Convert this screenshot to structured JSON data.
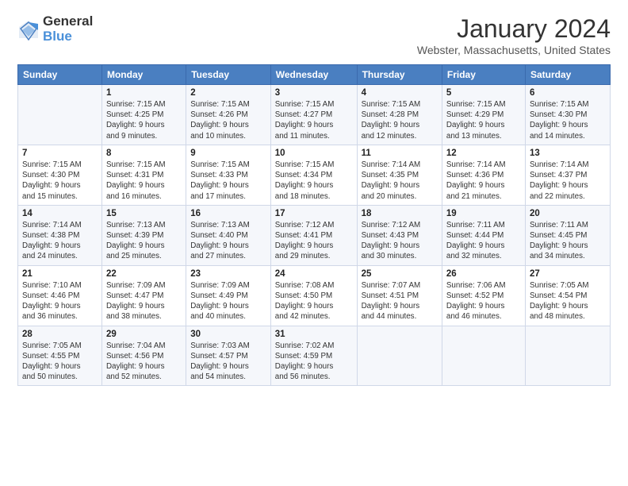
{
  "header": {
    "logo_general": "General",
    "logo_blue": "Blue",
    "month_year": "January 2024",
    "location": "Webster, Massachusetts, United States"
  },
  "days_of_week": [
    "Sunday",
    "Monday",
    "Tuesday",
    "Wednesday",
    "Thursday",
    "Friday",
    "Saturday"
  ],
  "weeks": [
    [
      {
        "day": "",
        "info": ""
      },
      {
        "day": "1",
        "info": "Sunrise: 7:15 AM\nSunset: 4:25 PM\nDaylight: 9 hours\nand 9 minutes."
      },
      {
        "day": "2",
        "info": "Sunrise: 7:15 AM\nSunset: 4:26 PM\nDaylight: 9 hours\nand 10 minutes."
      },
      {
        "day": "3",
        "info": "Sunrise: 7:15 AM\nSunset: 4:27 PM\nDaylight: 9 hours\nand 11 minutes."
      },
      {
        "day": "4",
        "info": "Sunrise: 7:15 AM\nSunset: 4:28 PM\nDaylight: 9 hours\nand 12 minutes."
      },
      {
        "day": "5",
        "info": "Sunrise: 7:15 AM\nSunset: 4:29 PM\nDaylight: 9 hours\nand 13 minutes."
      },
      {
        "day": "6",
        "info": "Sunrise: 7:15 AM\nSunset: 4:30 PM\nDaylight: 9 hours\nand 14 minutes."
      }
    ],
    [
      {
        "day": "7",
        "info": "Sunrise: 7:15 AM\nSunset: 4:30 PM\nDaylight: 9 hours\nand 15 minutes."
      },
      {
        "day": "8",
        "info": "Sunrise: 7:15 AM\nSunset: 4:31 PM\nDaylight: 9 hours\nand 16 minutes."
      },
      {
        "day": "9",
        "info": "Sunrise: 7:15 AM\nSunset: 4:33 PM\nDaylight: 9 hours\nand 17 minutes."
      },
      {
        "day": "10",
        "info": "Sunrise: 7:15 AM\nSunset: 4:34 PM\nDaylight: 9 hours\nand 18 minutes."
      },
      {
        "day": "11",
        "info": "Sunrise: 7:14 AM\nSunset: 4:35 PM\nDaylight: 9 hours\nand 20 minutes."
      },
      {
        "day": "12",
        "info": "Sunrise: 7:14 AM\nSunset: 4:36 PM\nDaylight: 9 hours\nand 21 minutes."
      },
      {
        "day": "13",
        "info": "Sunrise: 7:14 AM\nSunset: 4:37 PM\nDaylight: 9 hours\nand 22 minutes."
      }
    ],
    [
      {
        "day": "14",
        "info": "Sunrise: 7:14 AM\nSunset: 4:38 PM\nDaylight: 9 hours\nand 24 minutes."
      },
      {
        "day": "15",
        "info": "Sunrise: 7:13 AM\nSunset: 4:39 PM\nDaylight: 9 hours\nand 25 minutes."
      },
      {
        "day": "16",
        "info": "Sunrise: 7:13 AM\nSunset: 4:40 PM\nDaylight: 9 hours\nand 27 minutes."
      },
      {
        "day": "17",
        "info": "Sunrise: 7:12 AM\nSunset: 4:41 PM\nDaylight: 9 hours\nand 29 minutes."
      },
      {
        "day": "18",
        "info": "Sunrise: 7:12 AM\nSunset: 4:43 PM\nDaylight: 9 hours\nand 30 minutes."
      },
      {
        "day": "19",
        "info": "Sunrise: 7:11 AM\nSunset: 4:44 PM\nDaylight: 9 hours\nand 32 minutes."
      },
      {
        "day": "20",
        "info": "Sunrise: 7:11 AM\nSunset: 4:45 PM\nDaylight: 9 hours\nand 34 minutes."
      }
    ],
    [
      {
        "day": "21",
        "info": "Sunrise: 7:10 AM\nSunset: 4:46 PM\nDaylight: 9 hours\nand 36 minutes."
      },
      {
        "day": "22",
        "info": "Sunrise: 7:09 AM\nSunset: 4:47 PM\nDaylight: 9 hours\nand 38 minutes."
      },
      {
        "day": "23",
        "info": "Sunrise: 7:09 AM\nSunset: 4:49 PM\nDaylight: 9 hours\nand 40 minutes."
      },
      {
        "day": "24",
        "info": "Sunrise: 7:08 AM\nSunset: 4:50 PM\nDaylight: 9 hours\nand 42 minutes."
      },
      {
        "day": "25",
        "info": "Sunrise: 7:07 AM\nSunset: 4:51 PM\nDaylight: 9 hours\nand 44 minutes."
      },
      {
        "day": "26",
        "info": "Sunrise: 7:06 AM\nSunset: 4:52 PM\nDaylight: 9 hours\nand 46 minutes."
      },
      {
        "day": "27",
        "info": "Sunrise: 7:05 AM\nSunset: 4:54 PM\nDaylight: 9 hours\nand 48 minutes."
      }
    ],
    [
      {
        "day": "28",
        "info": "Sunrise: 7:05 AM\nSunset: 4:55 PM\nDaylight: 9 hours\nand 50 minutes."
      },
      {
        "day": "29",
        "info": "Sunrise: 7:04 AM\nSunset: 4:56 PM\nDaylight: 9 hours\nand 52 minutes."
      },
      {
        "day": "30",
        "info": "Sunrise: 7:03 AM\nSunset: 4:57 PM\nDaylight: 9 hours\nand 54 minutes."
      },
      {
        "day": "31",
        "info": "Sunrise: 7:02 AM\nSunset: 4:59 PM\nDaylight: 9 hours\nand 56 minutes."
      },
      {
        "day": "",
        "info": ""
      },
      {
        "day": "",
        "info": ""
      },
      {
        "day": "",
        "info": ""
      }
    ]
  ]
}
